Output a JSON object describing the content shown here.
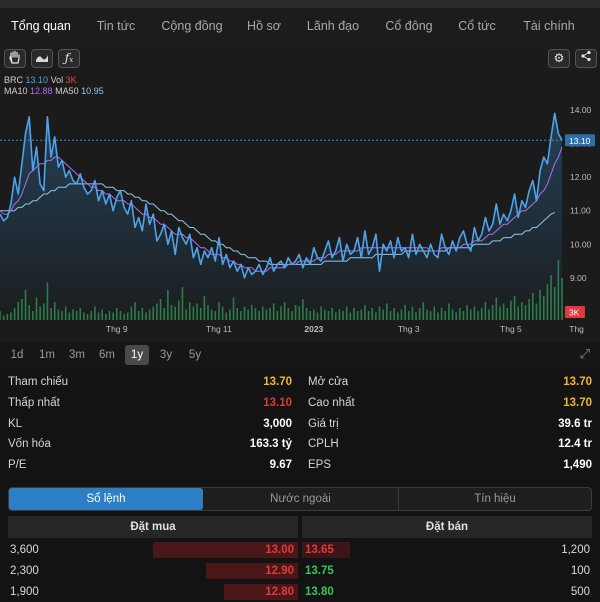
{
  "tabs": [
    "Tổng quan",
    "Tin tức",
    "Cộng đồng",
    "Hồ sơ",
    "Lãnh đạo",
    "Cổ đông",
    "Cổ tức",
    "Tài chính"
  ],
  "chart": {
    "legend": {
      "ticker": "BRC",
      "price": "13.10",
      "vol_label": "Vol",
      "vol_value": "3K",
      "ma10_label": "MA10",
      "ma10_value": "12.88",
      "ma50_label": "MA50",
      "ma50_value": "10.95"
    },
    "price_badge": "13.10",
    "vol_badge": "3K",
    "colors": {
      "price": "#4ea3ea",
      "ma10": "#b06cf0",
      "ma50": "#8dc8f0",
      "volume": "#2e8f4a",
      "badge": "#e0393e"
    }
  },
  "chart_data": {
    "type": "line",
    "y_ticks": [
      "14.00",
      "13.00",
      "12.00",
      "11.00",
      "10.00",
      "9.00"
    ],
    "ylim": [
      8.4,
      14.3
    ],
    "x_ticks": [
      "Thg 9",
      "Thg 11",
      "2023",
      "Thg 3",
      "Thg 5",
      "Thg"
    ],
    "price": [
      10.9,
      10.7,
      10.8,
      11.2,
      12.0,
      11.5,
      12.4,
      13.3,
      13.8,
      12.2,
      12.9,
      11.8,
      11.6,
      13.8,
      12.6,
      13.2,
      12.3,
      12.5,
      12.0,
      12.2,
      11.9,
      11.8,
      12.1,
      11.7,
      11.5,
      11.6,
      11.9,
      11.3,
      11.6,
      11.2,
      11.5,
      11.0,
      11.4,
      11.6,
      11.1,
      10.9,
      11.3,
      10.5,
      10.8,
      10.4,
      11.2,
      10.6,
      10.9,
      10.1,
      10.3,
      10.6,
      10.0,
      10.4,
      9.7,
      10.5,
      10.2,
      10.0,
      10.3,
      9.6,
      9.9,
      9.4,
      9.8,
      9.6,
      9.9,
      9.5,
      10.2,
      9.4,
      9.7,
      9.3,
      9.5,
      9.2,
      9.4,
      9.0,
      9.3,
      9.1,
      9.2,
      9.4,
      9.1,
      9.3,
      9.6,
      9.2,
      9.4,
      9.5,
      9.3,
      9.6,
      9.4,
      9.5,
      9.7,
      9.3,
      9.6,
      9.4,
      9.9,
      9.6,
      9.5,
      9.8,
      10.1,
      9.6,
      9.8,
      10.2,
      9.5,
      10.0,
      9.7,
      9.8,
      10.2,
      9.6,
      10.4,
      9.7,
      9.9,
      10.3,
      9.2,
      10.0,
      9.8,
      10.1,
      9.6,
      10.2,
      9.8,
      9.9,
      9.6,
      10.3,
      9.7,
      10.0,
      9.8,
      9.6,
      10.0,
      9.7,
      9.6,
      10.3,
      9.9,
      9.7,
      10.1,
      9.8,
      10.2,
      10.4,
      10.0,
      9.8,
      10.5,
      10.1,
      10.3,
      10.8,
      10.4,
      10.6,
      11.2,
      10.6,
      10.9,
      10.7,
      11.0,
      11.5,
      10.8,
      11.3,
      11.1,
      11.6,
      11.9,
      11.3,
      12.2,
      12.6,
      12.4,
      13.2,
      13.9,
      13.3,
      13.1
    ],
    "ma10": [
      11.0,
      10.9,
      10.9,
      11.0,
      11.2,
      11.3,
      11.5,
      11.8,
      12.1,
      12.2,
      12.3,
      12.4,
      12.4,
      12.5,
      12.5,
      12.6,
      12.6,
      12.5,
      12.4,
      12.3,
      12.2,
      12.1,
      12.0,
      11.9,
      11.8,
      11.7,
      11.7,
      11.6,
      11.6,
      11.5,
      11.5,
      11.4,
      11.3,
      11.3,
      11.3,
      11.2,
      11.2,
      11.1,
      11.0,
      10.9,
      10.9,
      10.8,
      10.8,
      10.7,
      10.6,
      10.6,
      10.5,
      10.4,
      10.3,
      10.3,
      10.3,
      10.2,
      10.2,
      10.1,
      10.0,
      9.9,
      9.9,
      9.8,
      9.7,
      9.7,
      9.7,
      9.6,
      9.6,
      9.5,
      9.5,
      9.4,
      9.4,
      9.3,
      9.3,
      9.3,
      9.2,
      9.2,
      9.2,
      9.2,
      9.3,
      9.3,
      9.3,
      9.3,
      9.3,
      9.4,
      9.4,
      9.4,
      9.5,
      9.5,
      9.5,
      9.5,
      9.5,
      9.6,
      9.6,
      9.6,
      9.7,
      9.7,
      9.7,
      9.8,
      9.8,
      9.8,
      9.8,
      9.8,
      9.8,
      9.9,
      9.9,
      9.9,
      9.9,
      9.9,
      9.9,
      9.9,
      9.9,
      9.9,
      9.9,
      9.9,
      9.9,
      9.9,
      9.9,
      9.9,
      9.9,
      9.9,
      9.9,
      9.9,
      9.8,
      9.8,
      9.8,
      9.9,
      9.9,
      9.9,
      9.9,
      9.9,
      9.9,
      10.0,
      10.0,
      10.0,
      10.1,
      10.1,
      10.1,
      10.2,
      10.3,
      10.3,
      10.4,
      10.5,
      10.6,
      10.6,
      10.7,
      10.8,
      10.9,
      11.0,
      11.0,
      11.1,
      11.2,
      11.3,
      11.5,
      11.6,
      11.8,
      12.1,
      12.4,
      12.6,
      12.9
    ],
    "ma50": [
      11.0,
      11.0,
      11.0,
      11.0,
      11.0,
      11.1,
      11.1,
      11.2,
      11.2,
      11.3,
      11.3,
      11.4,
      11.5,
      11.5,
      11.6,
      11.6,
      11.7,
      11.7,
      11.7,
      11.8,
      11.8,
      11.8,
      11.8,
      11.8,
      11.8,
      11.8,
      11.8,
      11.8,
      11.8,
      11.7,
      11.7,
      11.7,
      11.6,
      11.6,
      11.6,
      11.5,
      11.5,
      11.4,
      11.4,
      11.3,
      11.3,
      11.2,
      11.2,
      11.1,
      11.0,
      11.0,
      10.9,
      10.9,
      10.8,
      10.7,
      10.7,
      10.6,
      10.5,
      10.5,
      10.4,
      10.3,
      10.3,
      10.2,
      10.1,
      10.1,
      10.0,
      10.0,
      9.9,
      9.9,
      9.8,
      9.8,
      9.7,
      9.7,
      9.6,
      9.6,
      9.6,
      9.5,
      9.5,
      9.5,
      9.4,
      9.4,
      9.4,
      9.4,
      9.4,
      9.4,
      9.4,
      9.4,
      9.4,
      9.4,
      9.4,
      9.4,
      9.4,
      9.4,
      9.4,
      9.5,
      9.5,
      9.5,
      9.5,
      9.5,
      9.5,
      9.5,
      9.6,
      9.6,
      9.6,
      9.6,
      9.6,
      9.6,
      9.6,
      9.7,
      9.7,
      9.7,
      9.7,
      9.7,
      9.7,
      9.7,
      9.7,
      9.8,
      9.8,
      9.8,
      9.8,
      9.8,
      9.8,
      9.8,
      9.8,
      9.8,
      9.8,
      9.8,
      9.8,
      9.9,
      9.9,
      9.9,
      9.9,
      9.9,
      9.9,
      9.9,
      10.0,
      10.0,
      10.0,
      10.0,
      10.0,
      10.1,
      10.1,
      10.1,
      10.2,
      10.2,
      10.2,
      10.3,
      10.3,
      10.3,
      10.4,
      10.4,
      10.5,
      10.5,
      10.6,
      10.7,
      10.8,
      10.9,
      10.95
    ],
    "volume": [
      6,
      3,
      4,
      5,
      8,
      12,
      14,
      20,
      10,
      6,
      15,
      9,
      11,
      25,
      8,
      12,
      7,
      6,
      9,
      5,
      7,
      6,
      8,
      5,
      4,
      6,
      9,
      5,
      7,
      4,
      6,
      5,
      8,
      6,
      4,
      5,
      9,
      12,
      6,
      8,
      5,
      7,
      9,
      11,
      14,
      8,
      20,
      10,
      9,
      13,
      22,
      7,
      12,
      9,
      11,
      8,
      16,
      10,
      7,
      6,
      12,
      9,
      5,
      7,
      15,
      8,
      6,
      9,
      7,
      10,
      8,
      6,
      9,
      7,
      8,
      11,
      6,
      9,
      12,
      8,
      6,
      10,
      9,
      14,
      8,
      6,
      7,
      5,
      9,
      7,
      6,
      8,
      5,
      7,
      6,
      9,
      5,
      8,
      6,
      7,
      10,
      6,
      8,
      5,
      9,
      7,
      11,
      6,
      8,
      5,
      7,
      10,
      6,
      9,
      5,
      8,
      12,
      7,
      6,
      9,
      5,
      8,
      6,
      11,
      7,
      5,
      8,
      6,
      10,
      7,
      9,
      6,
      8,
      12,
      7,
      10,
      15,
      9,
      11,
      8,
      13,
      16,
      9,
      12,
      10,
      14,
      18,
      11,
      20,
      16,
      24,
      30,
      22,
      40,
      28
    ],
    "x_tick_index": [
      32,
      60,
      86,
      112,
      140,
      158
    ],
    "grid": false
  },
  "ranges": [
    "1d",
    "1m",
    "3m",
    "6m",
    "1y",
    "3y",
    "5y"
  ],
  "active_range": "1y",
  "stats": {
    "left": [
      {
        "label": "Tham chiếu",
        "value": "13.70"
      },
      {
        "label": "Thấp nhất",
        "value": "13.10"
      },
      {
        "label": "KL",
        "value": "3,000"
      },
      {
        "label": "Vốn hóa",
        "value": "163.3 tỷ"
      },
      {
        "label": "P/E",
        "value": "9.67"
      }
    ],
    "right": [
      {
        "label": "Mở cửa",
        "value": "13.70"
      },
      {
        "label": "Cao nhất",
        "value": "13.70"
      },
      {
        "label": "Giá trị",
        "value": "39.6 tr"
      },
      {
        "label": "CPLH",
        "value": "12.4 tr"
      },
      {
        "label": "EPS",
        "value": "1,490"
      }
    ]
  },
  "segments": [
    "Sổ lệnh",
    "Nước ngoài",
    "Tín hiệu"
  ],
  "orderbook": {
    "bid_header": "Đặt mua",
    "ask_header": "Đặt bán",
    "rows": [
      {
        "bid_vol": "3,600",
        "bid_price": "13.00",
        "ask_price": "13.65",
        "ask_vol": "1,200"
      },
      {
        "bid_vol": "2,300",
        "bid_price": "12.90",
        "ask_price": "13.75",
        "ask_vol": "100"
      },
      {
        "bid_vol": "1,900",
        "bid_price": "12.80",
        "ask_price": "13.80",
        "ask_vol": "500"
      }
    ]
  }
}
